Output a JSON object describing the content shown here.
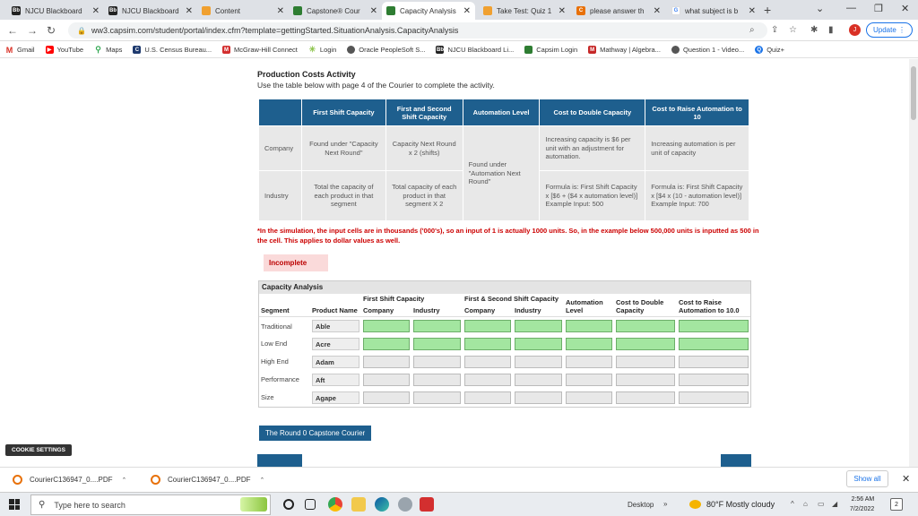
{
  "browser": {
    "tabs": [
      {
        "label": "NJCU Blackboard",
        "icon": "blackboard-icon",
        "active": false
      },
      {
        "label": "NJCU Blackboard",
        "icon": "blackboard-icon",
        "active": false
      },
      {
        "label": "Content",
        "icon": "content-icon",
        "active": false
      },
      {
        "label": "Capstone® Cour",
        "icon": "capsim-icon",
        "active": false
      },
      {
        "label": "Capacity Analysis",
        "icon": "capsim-icon",
        "active": true
      },
      {
        "label": "Take Test: Quiz 1",
        "icon": "test-icon",
        "active": false
      },
      {
        "label": "please answer th",
        "icon": "chegg-icon",
        "active": false
      },
      {
        "label": "what subject is b",
        "icon": "google-icon",
        "active": false
      }
    ],
    "url": "ww3.capsim.com/student/portal/index.cfm?template=gettingStarted.SituationAnalysis.CapacityAnalysis",
    "update_label": "Update",
    "profile_initial": "J",
    "bookmarks": [
      {
        "label": "Gmail",
        "icon": "gmail-icon",
        "color": "#d93025"
      },
      {
        "label": "YouTube",
        "icon": "youtube-icon",
        "color": "#ff0000"
      },
      {
        "label": "Maps",
        "icon": "maps-icon",
        "color": "#34a853"
      },
      {
        "label": "U.S. Census Bureau...",
        "icon": "census-icon",
        "color": "#1e3a6e"
      },
      {
        "label": "McGraw-Hill Connect",
        "icon": "mcgraw-icon",
        "color": "#d32f2f"
      },
      {
        "label": "Login",
        "icon": "login-icon",
        "color": "#8bc34a"
      },
      {
        "label": "Oracle PeopleSoft S...",
        "icon": "globe-icon",
        "color": "#555555"
      },
      {
        "label": "NJCU Blackboard Li...",
        "icon": "blackboard-icon",
        "color": "#222222"
      },
      {
        "label": "Capsim Login",
        "icon": "capsim-icon",
        "color": "#2e7d32"
      },
      {
        "label": "Mathway | Algebra...",
        "icon": "mathway-icon",
        "color": "#c62828"
      },
      {
        "label": "Question 1 - Video...",
        "icon": "globe-icon",
        "color": "#555555"
      },
      {
        "label": "Quiz+",
        "icon": "quizplus-icon",
        "color": "#1a73e8"
      }
    ]
  },
  "page": {
    "title": "Production Costs Activity",
    "subtitle": "Use the table below with page 4 of the Courier to complete the activity.",
    "reference_table": {
      "headers": [
        "",
        "First Shift Capacity",
        "First and Second Shift Capacity",
        "Automation Level",
        "Cost to Double Capacity",
        "Cost to Raise Automation to 10"
      ],
      "company_row": {
        "label": "Company",
        "first_shift": "Found under \"Capacity Next Round\"",
        "first_second": "Capacity Next Round x 2 (shifts)",
        "automation": "Found under \"Automation Next Round\"",
        "cost_double": "Increasing capacity is $6 per unit with an adjustment for automation.",
        "cost_raise": "Increasing automation is per unit of capacity"
      },
      "industry_row": {
        "label": "Industry",
        "first_shift": "Total the capacity of each product in that segment",
        "first_second": "Total capacity of each product in that segment X 2",
        "cost_double": "Formula is: First Shift Capacity x [$6 + ($4 x automation level)] Example Input: 500",
        "cost_raise": "Formula is: First Shift Capacity x [$4 x (10 - automation level)] Example Input: 700"
      }
    },
    "note": "*In the simulation, the input cells are in thousands ('000's), so an input of 1 is actually 1000 units. So, in the example below 500,000 units is inputted as 500 in the cell. This applies to dollar values as well.",
    "status_label": "Incomplete",
    "capacity_analysis": {
      "title": "Capacity Analysis",
      "headers": {
        "segment": "Segment",
        "product": "Product Name",
        "first_shift": "First Shift Capacity",
        "first_second": "First & Second Shift Capacity",
        "automation": "Automation Level",
        "cost_double": "Cost to Double Capacity",
        "cost_raise": "Cost to Raise Automation to 10.0",
        "company": "Company",
        "industry": "Industry"
      },
      "rows": [
        {
          "segment": "Traditional",
          "product": "Able"
        },
        {
          "segment": "Low End",
          "product": "Acre"
        },
        {
          "segment": "High End",
          "product": "Adam"
        },
        {
          "segment": "Performance",
          "product": "Aft"
        },
        {
          "segment": "Size",
          "product": "Agape"
        }
      ]
    },
    "courier_button": "The Round 0 Capstone Courier",
    "cookie_button": "COOKIE SETTINGS"
  },
  "downloads": {
    "items": [
      "CourierC136947_0....PDF",
      "CourierC136947_0....PDF"
    ],
    "show_all": "Show all"
  },
  "taskbar": {
    "search_placeholder": "Type here to search",
    "desktop_label": "Desktop",
    "weather": "80°F  Mostly cloudy",
    "time": "2:56 AM",
    "date": "7/2/2022",
    "notification_count": "2"
  }
}
